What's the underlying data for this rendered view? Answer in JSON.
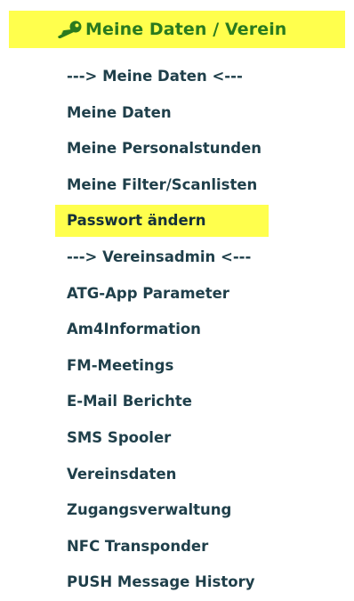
{
  "header": {
    "title": "Meine Daten / Verein",
    "icon": "key-icon"
  },
  "colors": {
    "highlight": "#ffff4d",
    "header_text": "#2a7a1e",
    "item_text": "#1f3f4a"
  },
  "menu": {
    "items": [
      {
        "label": "---> Meine Daten <---",
        "type": "section"
      },
      {
        "label": "Meine Daten",
        "type": "item"
      },
      {
        "label": "Meine Personalstunden",
        "type": "item"
      },
      {
        "label": "Meine Filter/Scanlisten",
        "type": "item"
      },
      {
        "label": "Passwort ändern",
        "type": "item",
        "active": true
      },
      {
        "label": "---> Vereinsadmin <---",
        "type": "section"
      },
      {
        "label": "ATG-App Parameter",
        "type": "item"
      },
      {
        "label": "Am4Information",
        "type": "item"
      },
      {
        "label": "FM-Meetings",
        "type": "item"
      },
      {
        "label": "E-Mail Berichte",
        "type": "item"
      },
      {
        "label": "SMS Spooler",
        "type": "item"
      },
      {
        "label": "Vereinsdaten",
        "type": "item"
      },
      {
        "label": "Zugangsverwaltung",
        "type": "item"
      },
      {
        "label": "NFC Transponder",
        "type": "item"
      },
      {
        "label": "PUSH Message History",
        "type": "item"
      }
    ]
  }
}
